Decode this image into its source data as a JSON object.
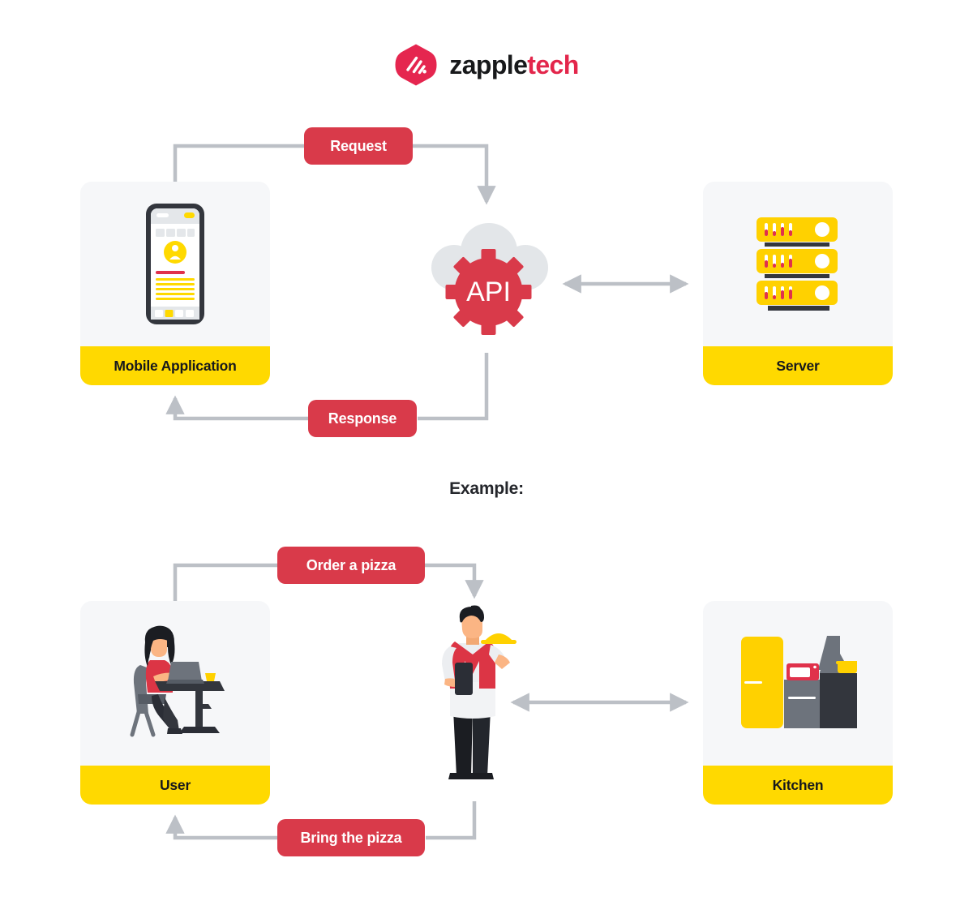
{
  "logo": {
    "mark_icon": "zappletech-diamond-slashes-icon",
    "word_part_1": "zapple",
    "word_part_2": "tech",
    "mark_color": "#e3264b",
    "word_dark_color": "#18191b",
    "word_accent_color": "#e3264b"
  },
  "colors": {
    "card_background": "#f6f7f9",
    "label_yellow": "#ffd900",
    "pill_red": "#d93a4a",
    "arrow_gray": "#bcc0c6",
    "cloud_gray": "#e3e6e9",
    "dark": "#33363d",
    "text_dark": "#16181c"
  },
  "top_diagram": {
    "cards": [
      {
        "id": "mobile",
        "label": "Mobile Application",
        "icon": "smartphone-icon"
      },
      {
        "id": "server",
        "label": "Server",
        "icon": "server-rack-icon"
      }
    ],
    "center": {
      "label": "API",
      "icon": "cloud-gear-api-icon"
    },
    "pills": [
      {
        "id": "request",
        "label": "Request"
      },
      {
        "id": "response",
        "label": "Response"
      }
    ],
    "connector": {
      "icon": "double-headed-arrow-icon"
    }
  },
  "example_heading": "Example:",
  "bottom_diagram": {
    "cards": [
      {
        "id": "user",
        "label": "User",
        "icon": "woman-at-desk-with-laptop-icon"
      },
      {
        "id": "kitchen",
        "label": "Kitchen",
        "icon": "kitchen-appliances-icon"
      }
    ],
    "center": {
      "label": "",
      "icon": "waiter-with-tray-icon"
    },
    "pills": [
      {
        "id": "order",
        "label": "Order a pizza"
      },
      {
        "id": "bring",
        "label": "Bring the pizza"
      }
    ],
    "connector": {
      "icon": "double-headed-arrow-icon"
    }
  }
}
